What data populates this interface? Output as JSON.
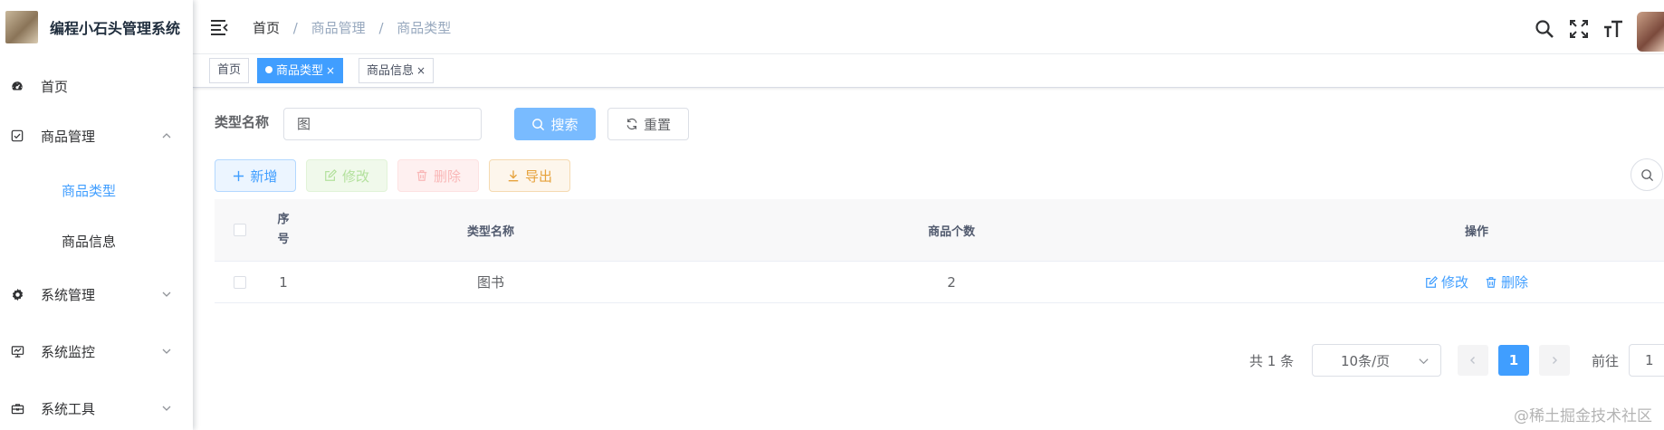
{
  "app": {
    "title": "编程小石头管理系统"
  },
  "sidebar": {
    "items": [
      {
        "label": "首页",
        "icon": "dashboard-icon"
      },
      {
        "label": "商品管理",
        "icon": "checkbox-icon",
        "expanded": true,
        "children": [
          {
            "label": "商品类型",
            "active": true
          },
          {
            "label": "商品信息"
          }
        ]
      },
      {
        "label": "系统管理",
        "icon": "gear-icon"
      },
      {
        "label": "系统监控",
        "icon": "monitor-icon"
      },
      {
        "label": "系统工具",
        "icon": "toolbox-icon"
      }
    ]
  },
  "navbar": {
    "breadcrumb": [
      "首页",
      "商品管理",
      "商品类型"
    ],
    "separator": "/"
  },
  "tags": [
    {
      "label": "首页"
    },
    {
      "label": "商品类型",
      "active": true,
      "close": "×"
    },
    {
      "label": "商品信息",
      "close": "×"
    }
  ],
  "search": {
    "label": "类型名称",
    "value": "图",
    "search_button": "搜索",
    "reset_button": "重置"
  },
  "toolbar": {
    "add": "新增",
    "edit": "修改",
    "delete": "删除",
    "export": "导出"
  },
  "table": {
    "headers": {
      "index_1": "序",
      "index_2": "号",
      "name": "类型名称",
      "count": "商品个数",
      "ops": "操作"
    },
    "rows": [
      {
        "index": "1",
        "name": "图书",
        "count": "2",
        "edit": "修改",
        "delete": "删除"
      }
    ]
  },
  "pagination": {
    "total": "共 1 条",
    "page_size": "10条/页",
    "current": "1",
    "goto_label": "前往",
    "goto_value": "1"
  },
  "watermark": "@稀土掘金技术社区",
  "colors": {
    "primary": "#409eff",
    "success": "#67c23a",
    "danger": "#f56c6c",
    "warning": "#e6a23c"
  }
}
